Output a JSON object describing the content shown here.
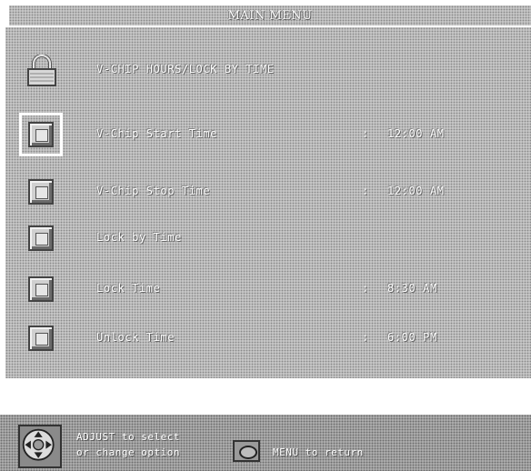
{
  "header": {
    "title": "MAIN MENU"
  },
  "section": {
    "title": "V-CHIP HOURS/LOCK BY TIME",
    "icon": "lock-icon"
  },
  "menu": {
    "items": [
      {
        "label": "V-Chip Start Time",
        "value": "12:00 AM",
        "selected": true
      },
      {
        "label": "V-Chip Stop Time",
        "value": "12:00 AM",
        "selected": false
      },
      {
        "label": "Lock by Time",
        "value": "",
        "selected": false
      },
      {
        "label": "Lock Time",
        "value": "8:30 AM",
        "selected": false
      },
      {
        "label": "Unlock Time",
        "value": "6:00 PM",
        "selected": false
      }
    ],
    "separator": ":"
  },
  "footer": {
    "adjust_line1": "ADJUST to select",
    "adjust_line2": "or change option",
    "menu_hint": "MENU to return",
    "dpad_icon": "dpad-icon",
    "menu_icon": "menu-button-icon"
  },
  "colors": {
    "background": "#b8b8b8",
    "text": "#ffffff",
    "selection": "#ffffff"
  }
}
